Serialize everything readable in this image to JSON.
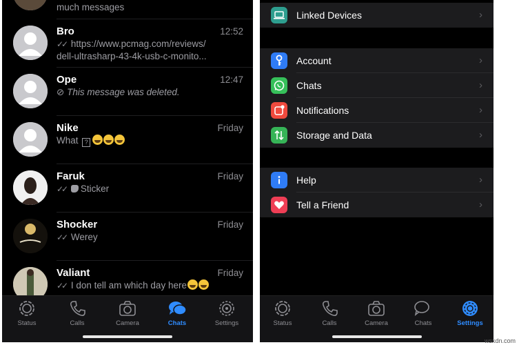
{
  "chats": {
    "top_partial_preview": "much messages",
    "items": [
      {
        "name": "Bro",
        "time": "12:52",
        "preview_line1": "https://www.pcmag.com/reviews/",
        "preview_line2": "dell-ultrasharp-43-4k-usb-c-monito...",
        "status": "read"
      },
      {
        "name": "Ope",
        "time": "12:47",
        "preview": "This message was deleted.",
        "status": "deleted"
      },
      {
        "name": "Nike",
        "time": "Friday",
        "preview": "What",
        "qbox": "?",
        "status": "none"
      },
      {
        "name": "Faruk",
        "time": "Friday",
        "preview": "Sticker",
        "status": "read"
      },
      {
        "name": "Shocker",
        "time": "Friday",
        "preview": "Werey",
        "status": "read"
      },
      {
        "name": "Valiant",
        "time": "Friday",
        "preview": "I don tell am which day here",
        "status": "read"
      }
    ]
  },
  "tabs_left": [
    {
      "label": "Status",
      "icon": "status-icon"
    },
    {
      "label": "Calls",
      "icon": "phone-icon"
    },
    {
      "label": "Camera",
      "icon": "camera-icon"
    },
    {
      "label": "Chats",
      "icon": "chats-icon",
      "active": true
    },
    {
      "label": "Settings",
      "icon": "gear-icon"
    }
  ],
  "settings": {
    "group1": [
      {
        "label": "Linked Devices",
        "icon": "laptop-icon",
        "color": "#2e9e8f"
      }
    ],
    "group2": [
      {
        "label": "Account",
        "icon": "key-icon",
        "color": "#2f7cf6"
      },
      {
        "label": "Chats",
        "icon": "whatsapp-icon",
        "color": "#36c05a"
      },
      {
        "label": "Notifications",
        "icon": "notification-icon",
        "color": "#ef4a3e"
      },
      {
        "label": "Storage and Data",
        "icon": "storage-icon",
        "color": "#36b457"
      }
    ],
    "group3": [
      {
        "label": "Help",
        "icon": "info-icon",
        "color": "#2f7cf6"
      },
      {
        "label": "Tell a Friend",
        "icon": "heart-icon",
        "color": "#ef3e55"
      }
    ]
  },
  "tabs_right": [
    {
      "label": "Status",
      "icon": "status-icon"
    },
    {
      "label": "Calls",
      "icon": "phone-icon"
    },
    {
      "label": "Camera",
      "icon": "camera-icon"
    },
    {
      "label": "Chats",
      "icon": "chats-icon"
    },
    {
      "label": "Settings",
      "icon": "gear-icon",
      "active": true
    }
  ],
  "colors": {
    "accent": "#2f8cff",
    "background": "#000000",
    "group_bg": "#1c1c1e"
  },
  "watermark": "wsxdn.com"
}
